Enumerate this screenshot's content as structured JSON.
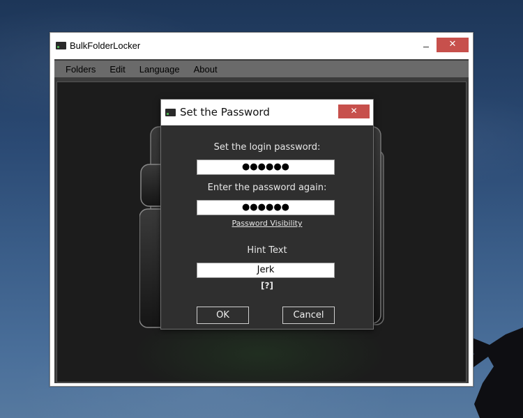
{
  "main_window": {
    "title": "BulkFolderLocker",
    "close_glyph": "✕",
    "menu": [
      "Folders",
      "Edit",
      "Language",
      "About"
    ]
  },
  "dialog": {
    "title": "Set the Password",
    "close_glyph": "✕",
    "login_password_label": "Set the login password:",
    "login_password_value": "●●●●●●",
    "confirm_password_label": "Enter the password again:",
    "confirm_password_value": "●●●●●●",
    "visibility_link": "Password Visibility",
    "hint_label": "Hint Text",
    "hint_value": "Jerk",
    "help_label": "[?]",
    "ok_label": "OK",
    "cancel_label": "Cancel"
  },
  "colors": {
    "close_button": "#c7504c",
    "dialog_background": "#2f2f2f",
    "menubar": "#6a6a6a"
  },
  "icons": [
    "app-icon",
    "minimize-icon",
    "close-icon",
    "folder-graphic"
  ]
}
